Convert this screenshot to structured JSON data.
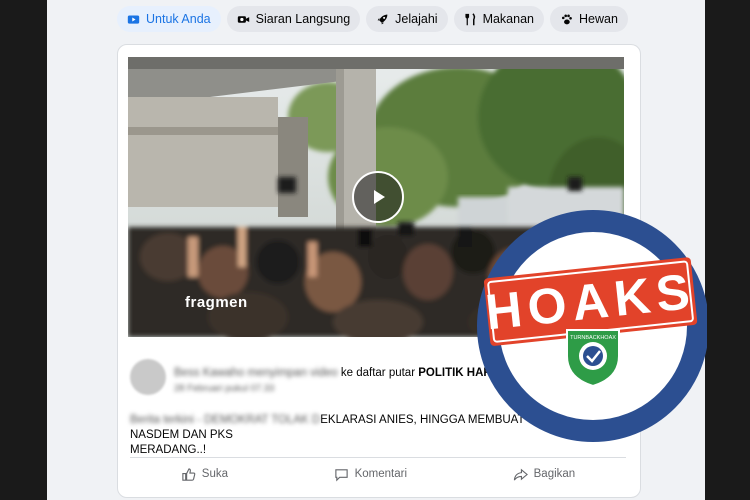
{
  "tabs": [
    {
      "label": "Untuk Anda",
      "icon": "play-icon",
      "active": true
    },
    {
      "label": "Siaran Langsung",
      "icon": "video-camera-icon",
      "active": false
    },
    {
      "label": "Jelajahi",
      "icon": "rocket-icon",
      "active": false
    },
    {
      "label": "Makanan",
      "icon": "utensils-icon",
      "active": false
    },
    {
      "label": "Hewan",
      "icon": "paw-icon",
      "active": false
    }
  ],
  "post": {
    "author_blurred": "Bess Kawaho",
    "action_blurred": "menyimpan video",
    "action_visible": "ke daftar putar",
    "playlist": "POLITIK HARI INI.",
    "date_blurred": "28 Februari pukul 07.33",
    "text_blurred": "Berita terkini - DEMOKRAT TOLAK D",
    "text_visible": "EKLARASI ANIES, HINGGA MEMBUAT NASDEM DAN PKS",
    "text_line2": "MERADANG..!",
    "video_watermark": "fragmen"
  },
  "actions": {
    "like": "Suka",
    "comment": "Komentari",
    "share": "Bagikan"
  },
  "stamp": {
    "label": "HOAKS",
    "badge_text": "TURNBACKHOAX",
    "colors": {
      "ring": "#2c4f91",
      "banner": "#e2432a",
      "badge": "#2e9c47"
    }
  },
  "colors": {
    "accent": "#1b74e4",
    "card": "#ffffff",
    "page": "#f0f2f5"
  }
}
